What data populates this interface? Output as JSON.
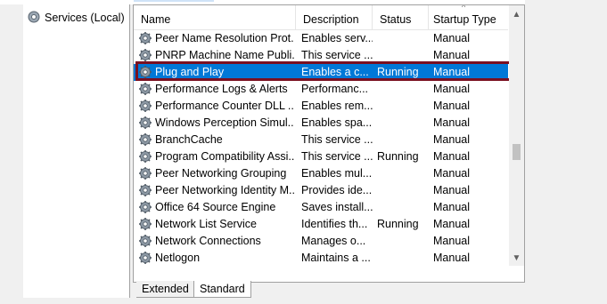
{
  "left_pane": {
    "label": "Services (Local)",
    "icon": "gear-icon"
  },
  "columns": {
    "name": "Name",
    "description": "Description",
    "status": "Status",
    "startup_type": "Startup Type"
  },
  "rows": [
    {
      "name": "Peer Name Resolution Prot...",
      "description": "Enables serv...",
      "status": "",
      "startup": "Manual"
    },
    {
      "name": "PNRP Machine Name Publi...",
      "description": "This service ...",
      "status": "",
      "startup": "Manual"
    },
    {
      "name": "Plug and Play",
      "description": "Enables a c...",
      "status": "Running",
      "startup": "Manual"
    },
    {
      "name": "Performance Logs & Alerts",
      "description": "Performanc...",
      "status": "",
      "startup": "Manual"
    },
    {
      "name": "Performance Counter DLL ...",
      "description": "Enables rem...",
      "status": "",
      "startup": "Manual"
    },
    {
      "name": "Windows Perception Simul...",
      "description": "Enables spa...",
      "status": "",
      "startup": "Manual"
    },
    {
      "name": "BranchCache",
      "description": "This service ...",
      "status": "",
      "startup": "Manual"
    },
    {
      "name": "Program Compatibility Assi...",
      "description": "This service ...",
      "status": "Running",
      "startup": "Manual"
    },
    {
      "name": "Peer Networking Grouping",
      "description": "Enables mul...",
      "status": "",
      "startup": "Manual"
    },
    {
      "name": "Peer Networking Identity M...",
      "description": "Provides ide...",
      "status": "",
      "startup": "Manual"
    },
    {
      "name": "Office 64 Source Engine",
      "description": "Saves install...",
      "status": "",
      "startup": "Manual"
    },
    {
      "name": "Network List Service",
      "description": "Identifies th...",
      "status": "Running",
      "startup": "Manual"
    },
    {
      "name": "Network Connections",
      "description": "Manages o...",
      "status": "",
      "startup": "Manual"
    },
    {
      "name": "Netlogon",
      "description": "Maintains a ...",
      "status": "",
      "startup": "Manual"
    }
  ],
  "selected_index": 2,
  "tabs": {
    "extended": "Extended",
    "standard": "Standard"
  },
  "colors": {
    "selection": "#0078d7",
    "highlight_border": "#7a1020"
  }
}
